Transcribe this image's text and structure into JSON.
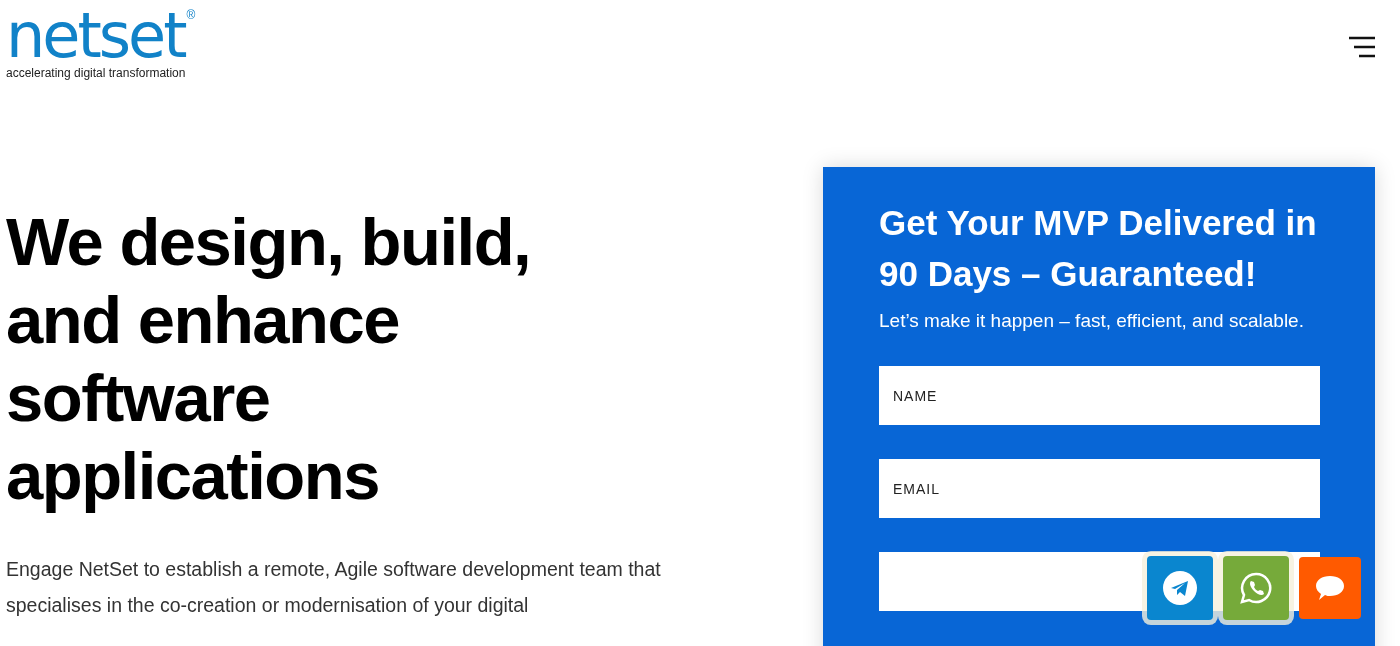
{
  "logo": {
    "name": "netset",
    "registered": "®",
    "tagline": "accelerating digital transformation"
  },
  "hero": {
    "heading": "We design, build, and enhance software applications",
    "text": "Engage NetSet to establish a remote, Agile software development team that specialises in the co-creation or modernisation of your digital"
  },
  "form": {
    "title": "Get Your MVP Delivered in 90 Days – Guaranteed!",
    "subtitle": "Let’s make it happen – fast, efficient, and scalable.",
    "fields": [
      {
        "placeholder": "NAME"
      },
      {
        "placeholder": "EMAIL"
      }
    ]
  },
  "floating_buttons": [
    {
      "kind": "telegram"
    },
    {
      "kind": "whatsapp"
    },
    {
      "kind": "chat"
    }
  ]
}
